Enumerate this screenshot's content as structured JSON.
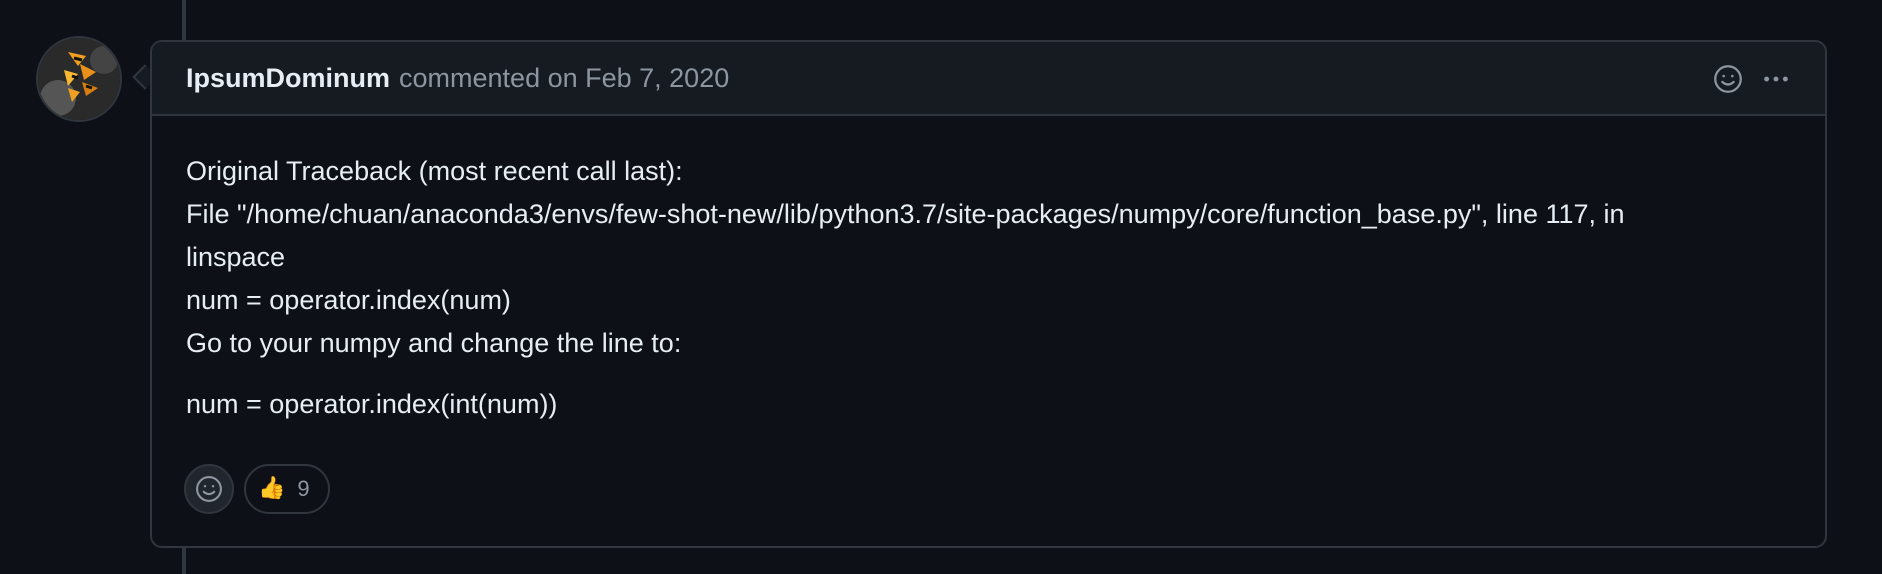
{
  "comment": {
    "author": "IpsumDominum",
    "meta": "commented on Feb 7, 2020",
    "body_lines": [
      "Original Traceback (most recent call last):",
      "File \"/home/chuan/anaconda3/envs/few-shot-new/lib/python3.7/site-packages/numpy/core/function_base.py\", line 117, in",
      "linspace",
      "num = operator.index(num)",
      "Go to your numpy and change the line to:"
    ],
    "body_final": "num = operator.index(int(num))",
    "header_icons": [
      "smiley-icon",
      "more-icon"
    ]
  },
  "reactions": {
    "add_icon": "smiley-icon",
    "items": [
      {
        "emoji": "👍",
        "emoji_name": "thumbs-up-icon",
        "count": "9"
      }
    ]
  },
  "colors": {
    "background": "#0d1117",
    "header_bg": "#161b22",
    "border": "#30363d",
    "text": "#e6edf3",
    "muted": "#8d96a0"
  }
}
